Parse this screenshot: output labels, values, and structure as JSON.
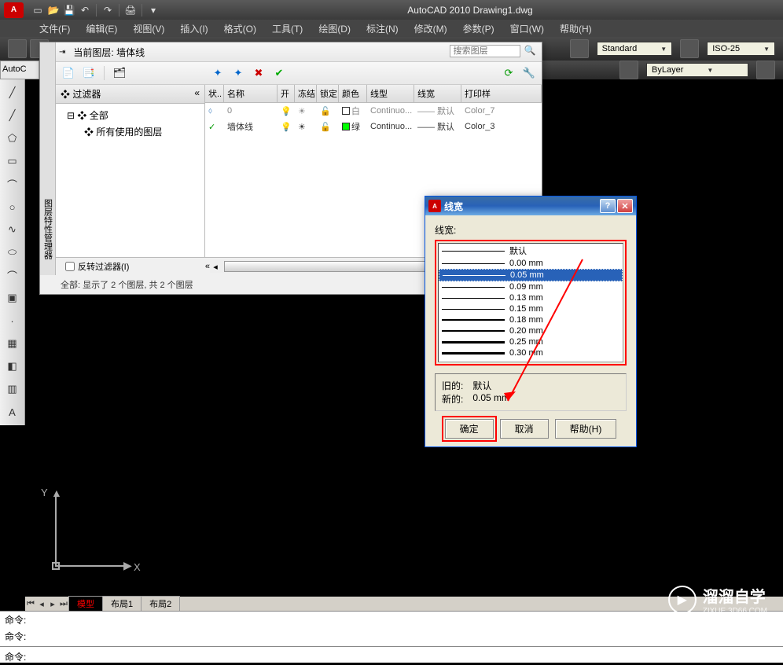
{
  "app": {
    "name": "AutoCAD 2010",
    "doc": "Drawing1.dwg"
  },
  "qat_title": "AutoCAD 2010   Drawing1.dwg",
  "menubar": [
    "文件(F)",
    "编辑(E)",
    "视图(V)",
    "插入(I)",
    "格式(O)",
    "工具(T)",
    "绘图(D)",
    "标注(N)",
    "修改(M)",
    "参数(P)",
    "窗口(W)",
    "帮助(H)"
  ],
  "ribbon": {
    "textStyle": "Standard",
    "dimStyle": "ISO-25",
    "byLayer": "ByLayer"
  },
  "layer_panel": {
    "vertical_title": "图层特性管理器",
    "title_prefix": "当前图层:",
    "current_layer": "墙体线",
    "search_placeholder": "搜索图层",
    "filter_header": "过滤器",
    "tree_root": "全部",
    "tree_sub": "所有使用的图层",
    "invert_filter": "反转过滤器(I)",
    "columns": [
      "状..",
      "名称",
      "开",
      "冻结",
      "锁定",
      "颜色",
      "线型",
      "线宽",
      "打印样"
    ],
    "rows": [
      {
        "status": "",
        "name": "0",
        "on": "💡",
        "freeze": "☀",
        "lock": "🔓",
        "color": "白",
        "color_swatch": "#ffffff",
        "linetype": "Continuo...",
        "weight": "—— 默认",
        "plot": "Color_7",
        "active": false
      },
      {
        "status": "✓",
        "name": "墙体线",
        "on": "💡",
        "freeze": "☀",
        "lock": "🔓",
        "color": "绿",
        "color_swatch": "#00ff00",
        "linetype": "Continuo...",
        "weight": "—— 默认",
        "plot": "Color_3",
        "active": true
      }
    ],
    "status_text": "全部: 显示了 2 个图层, 共 2 个图层"
  },
  "lineweight_dialog": {
    "title": "线宽",
    "list_label": "线宽:",
    "items": [
      {
        "label": "默认",
        "cls": ""
      },
      {
        "label": "0.00 mm",
        "cls": ""
      },
      {
        "label": "0.05 mm",
        "cls": "w05",
        "selected": true
      },
      {
        "label": "0.09 mm",
        "cls": "w09"
      },
      {
        "label": "0.13 mm",
        "cls": "w13"
      },
      {
        "label": "0.15 mm",
        "cls": "w15"
      },
      {
        "label": "0.18 mm",
        "cls": "w18"
      },
      {
        "label": "0.20 mm",
        "cls": "w20"
      },
      {
        "label": "0.25 mm",
        "cls": "w25"
      },
      {
        "label": "0.30 mm",
        "cls": "w30"
      }
    ],
    "old_label": "旧的:",
    "old_value": "默认",
    "new_label": "新的:",
    "new_value": "0.05 mm",
    "ok": "确定",
    "cancel": "取消",
    "help": "帮助(H)"
  },
  "tabs": {
    "model": "模型",
    "layout1": "布局1",
    "layout2": "布局2"
  },
  "cmd": {
    "prompt": "命令:"
  },
  "ucs": {
    "x": "X",
    "y": "Y"
  },
  "watermark": {
    "main": "溜溜自学",
    "sub": "ZIXUE.3D66.COM"
  },
  "autocad_text": "AutoC"
}
